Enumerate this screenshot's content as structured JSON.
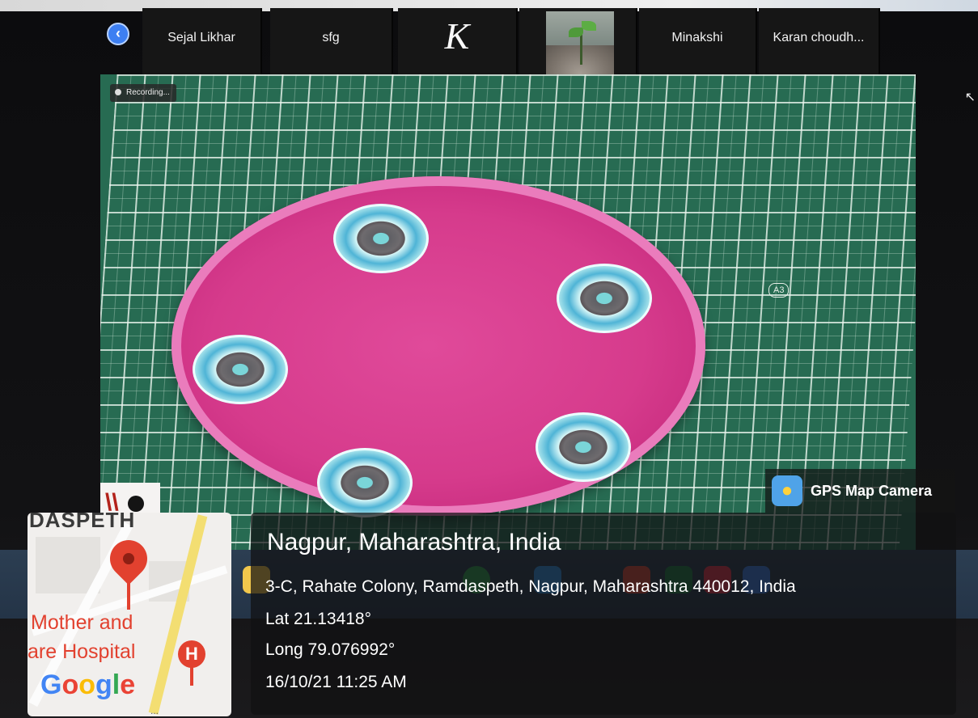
{
  "meeting": {
    "participants": [
      {
        "name": "Sejal Likhar"
      },
      {
        "name": "sfg"
      },
      {
        "initial": "K"
      },
      {
        "thumbnail": "plant-photo"
      },
      {
        "name": "Minakshi"
      },
      {
        "name": "Karan choudh..."
      }
    ],
    "recording_label": "Recording..."
  },
  "gps_overlay": {
    "brand": "GPS Map Camera",
    "city": "Nagpur, Maharashtra, India",
    "address": "3-C, Rahate Colony, Ramdaspeth, Nagpur, Maharashtra 440012, India",
    "lat": "Lat 21.13418°",
    "long": "Long 79.076992°",
    "datetime": "16/10/21 11:25 AM"
  },
  "map": {
    "street": "DASPETH",
    "poi_line1": "Mother and",
    "poi_line2": "are Hospital",
    "hospital_marker": "H",
    "provider_letters": [
      "G",
      "o",
      "o",
      "g",
      "l",
      "e"
    ],
    "more": "..."
  },
  "colors": {
    "accent": "#3d7ff2",
    "pin": "#e2412f",
    "dish": "#d63b8c",
    "board": "#276b52"
  }
}
